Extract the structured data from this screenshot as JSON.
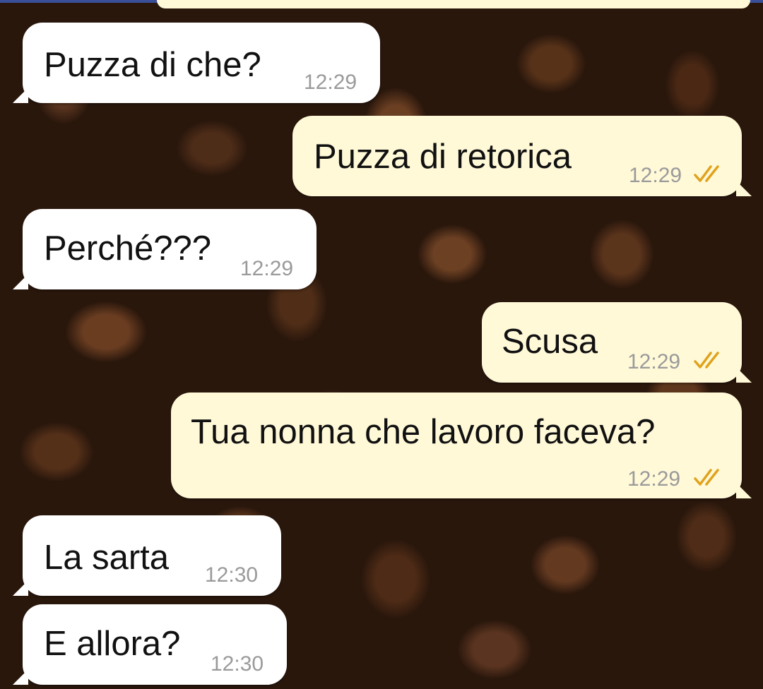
{
  "chat": {
    "messages": [
      {
        "direction": "incoming",
        "text": "Puzza di che?",
        "time": "12:29"
      },
      {
        "direction": "outgoing",
        "text": "Puzza di retorica",
        "time": "12:29",
        "status": "read"
      },
      {
        "direction": "incoming",
        "text": "Perché???",
        "time": "12:29"
      },
      {
        "direction": "outgoing",
        "text": "Scusa",
        "time": "12:29",
        "status": "read"
      },
      {
        "direction": "outgoing",
        "text": "Tua nonna che lavoro faceva?",
        "time": "12:29",
        "status": "read"
      },
      {
        "direction": "incoming",
        "text": "La sarta",
        "time": "12:30"
      },
      {
        "direction": "incoming",
        "text": "E allora?",
        "time": "12:30"
      }
    ]
  },
  "colors": {
    "incoming_bubble": "#ffffff",
    "outgoing_bubble": "#fff9d8",
    "read_tick": "#e0a21c",
    "timestamp": "#9a9a9a"
  },
  "icons": {
    "read_receipt": "double-check-icon"
  }
}
